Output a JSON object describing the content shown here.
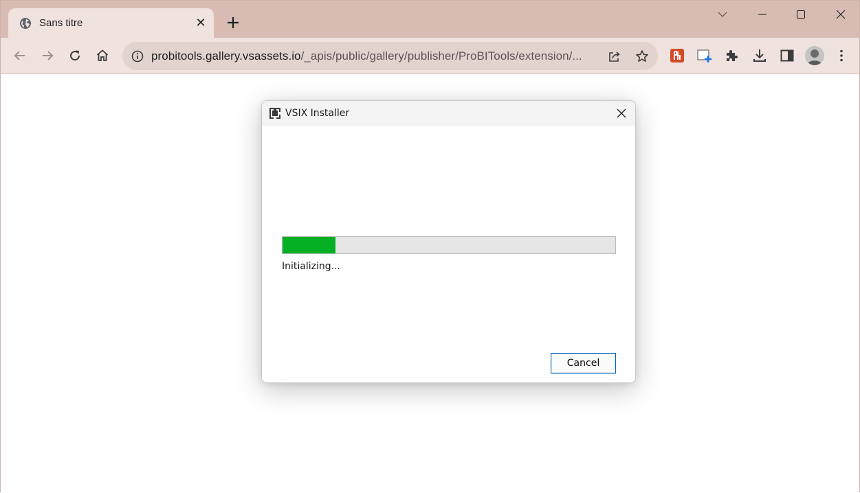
{
  "browser": {
    "tab": {
      "title": "Sans titre",
      "icon": "globe-icon",
      "close_glyph": "✕"
    },
    "new_tab_icon": "plus-icon",
    "window_controls": [
      "chevron-down-icon",
      "minimize-icon",
      "maximize-icon",
      "close-icon"
    ],
    "toolbar": {
      "nav": [
        "back-icon",
        "forward-icon",
        "reload-icon",
        "home-icon"
      ],
      "url_host": "probitools.gallery.vsassets.io",
      "url_path": "/_apis/public/gallery/publisher/ProBITools/extension/...",
      "extensions": [
        "red-extension-icon",
        "screenshot-extension-icon",
        "puzzle-icon",
        "download-icon",
        "sidepanel-icon",
        "avatar",
        "kebab-menu-icon"
      ]
    }
  },
  "dialog": {
    "title": "VSIX Installer",
    "progress_fraction": 0.16,
    "status": "Initializing...",
    "cancel_label": "Cancel"
  },
  "colors": {
    "tabbar": "#d8bcb4",
    "toolbar": "#efe2df",
    "progress_fill": "#06b025",
    "button_border": "#0067c0"
  }
}
